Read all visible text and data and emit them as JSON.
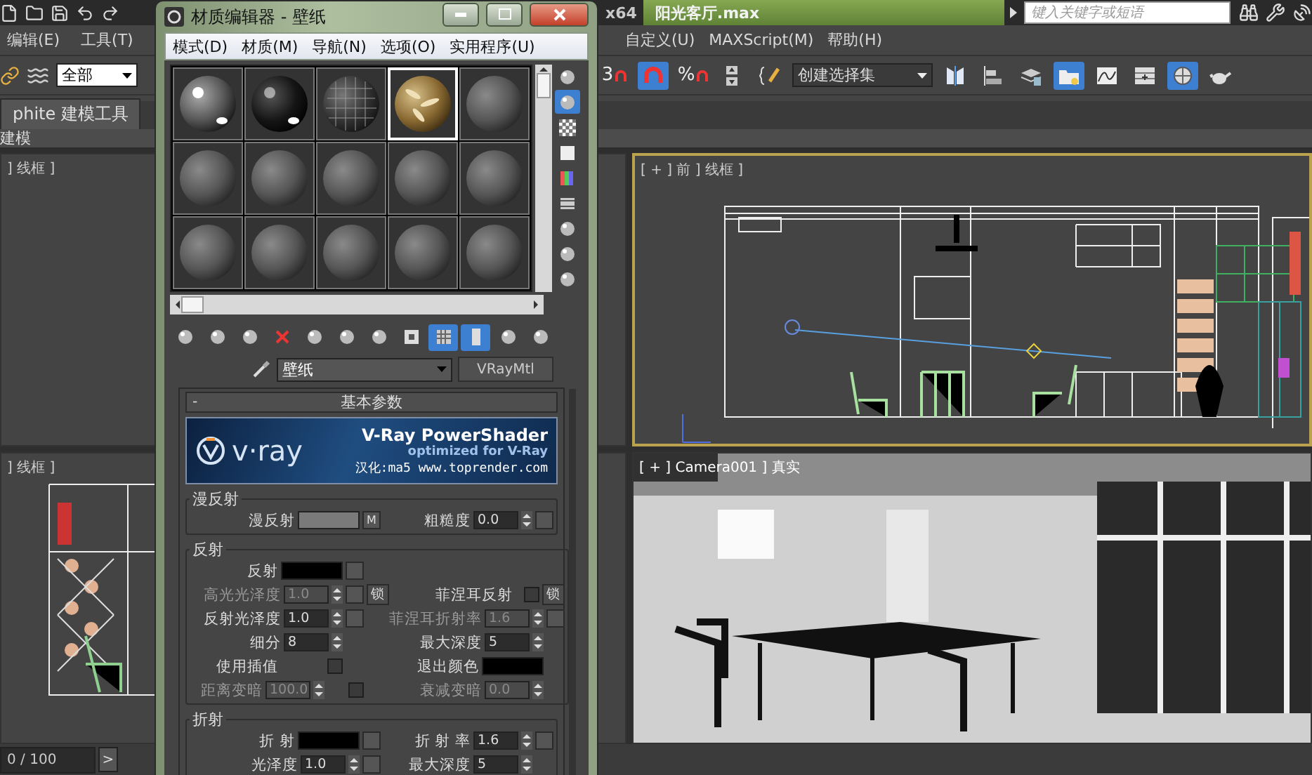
{
  "titlebar": {
    "arch": "x64",
    "file": "阳光客厅.max",
    "search": {
      "placeholder": "键入关键字或短语"
    }
  },
  "menus": {
    "left": [
      "编辑(E)",
      "工具(T)"
    ],
    "right": [
      "自定义(U)",
      "MAXScript(M)",
      "帮助(H)"
    ]
  },
  "toolbar": {
    "selection_filter": "全部",
    "tools": [
      {
        "kind": "snap",
        "label": "3",
        "on": false
      },
      {
        "kind": "angle-snap",
        "on": true
      },
      {
        "kind": "snap",
        "label": "%",
        "on": false
      },
      {
        "kind": "spinner-snap",
        "on": false
      },
      {
        "kind": "edit-named",
        "on": false
      },
      {
        "kind": "named-selection",
        "value": "创建选择集"
      },
      {
        "kind": "mirror",
        "on": false
      },
      {
        "kind": "align",
        "on": false
      },
      {
        "kind": "layers",
        "on": false
      },
      {
        "kind": "explorer",
        "on": true
      },
      {
        "kind": "curve-editor",
        "on": false
      },
      {
        "kind": "schematic",
        "on": false
      },
      {
        "kind": "render-setup",
        "on": true
      },
      {
        "kind": "teapot",
        "on": false
      }
    ]
  },
  "ribbon": {
    "tab": "phite 建模工具",
    "panel": "建模"
  },
  "viewport_top_left": {
    "label": "] 线框 ]",
    "active": false
  },
  "viewport_front": {
    "label": "[ + ] 前 ] 线框 ]",
    "active": true
  },
  "viewport_bottom_left": {
    "label": "] 线框 ]",
    "active": false
  },
  "viewport_camera": {
    "label": "[ + ] Camera001 ] 真实",
    "active": false
  },
  "timeslider": {
    "frame": "0 / 100",
    "next": ">"
  },
  "material_editor": {
    "title": "材质编辑器 - 壁纸",
    "menus": [
      "模式(D)",
      "材质(M)",
      "导航(N)",
      "选项(O)",
      "实用程序(U)"
    ],
    "slots": [
      {
        "kind": "glossy",
        "selected": false
      },
      {
        "kind": "dark",
        "selected": false
      },
      {
        "kind": "mesh",
        "selected": false
      },
      {
        "kind": "wood",
        "selected": true
      },
      {
        "kind": "plain",
        "selected": false
      },
      {
        "kind": "plain",
        "selected": false
      },
      {
        "kind": "plain",
        "selected": false
      },
      {
        "kind": "plain",
        "selected": false
      },
      {
        "kind": "plain",
        "selected": false
      },
      {
        "kind": "plain",
        "selected": false
      },
      {
        "kind": "plain",
        "selected": false
      },
      {
        "kind": "plain",
        "selected": false
      },
      {
        "kind": "plain",
        "selected": false
      },
      {
        "kind": "plain",
        "selected": false
      },
      {
        "kind": "plain",
        "selected": false
      }
    ],
    "side_tools": [
      {
        "kind": "sample-type",
        "on": false
      },
      {
        "kind": "backlight",
        "on": true
      },
      {
        "kind": "checker",
        "on": false
      },
      {
        "kind": "tiling",
        "on": false
      },
      {
        "kind": "video-check",
        "on": false
      },
      {
        "kind": "preview",
        "on": false
      },
      {
        "kind": "options",
        "on": false
      },
      {
        "kind": "select-by-material",
        "on": false
      },
      {
        "kind": "navigator",
        "on": false
      }
    ],
    "tools": [
      {
        "kind": "get",
        "on": false
      },
      {
        "kind": "put",
        "on": false
      },
      {
        "kind": "assign",
        "on": false
      },
      {
        "kind": "reset",
        "on": false
      },
      {
        "kind": "copy",
        "on": false
      },
      {
        "kind": "unique",
        "on": false
      },
      {
        "kind": "library",
        "on": false
      },
      {
        "kind": "effects",
        "on": false
      },
      {
        "kind": "show-map",
        "on": true
      },
      {
        "kind": "end-result",
        "on": true
      },
      {
        "kind": "parent",
        "on": false
      },
      {
        "kind": "sibling",
        "on": false
      }
    ],
    "material_name": "壁纸",
    "material_type": "VRayMtl",
    "rollout": {
      "collapse": "-",
      "title": "基本参数"
    },
    "banner": {
      "logo": "v·ray",
      "title": "V-Ray PowerShader",
      "subtitle": "optimized for V-Ray",
      "credit": "汉化:ma5 www.toprender.com"
    },
    "groups": [
      {
        "title": "漫反射",
        "rows": [
          [
            {
              "label": "漫反射",
              "kind": "swatch",
              "color": "#7a7a7a",
              "map": "M"
            },
            {
              "label": "粗糙度",
              "kind": "spinner",
              "value": "0.0",
              "disabled": false,
              "slot": true
            }
          ]
        ]
      },
      {
        "title": "反射",
        "rows": [
          [
            {
              "label": "反射",
              "kind": "swatch",
              "color": "#000000",
              "slot": true
            }
          ],
          [
            {
              "label": "高光光泽度",
              "kind": "spinner",
              "value": "1.0",
              "disabled": true,
              "slot": true,
              "lock": "锁"
            },
            {
              "label": "菲涅耳反射",
              "kind": "check",
              "checked": false,
              "lock": "锁"
            }
          ],
          [
            {
              "label": "反射光泽度",
              "kind": "spinner",
              "value": "1.0",
              "disabled": false,
              "slot": true
            },
            {
              "label": "菲涅耳折射率",
              "kind": "spinner",
              "value": "1.6",
              "disabled": true,
              "slot": true
            }
          ],
          [
            {
              "label": "细分",
              "kind": "spinner",
              "value": "8",
              "disabled": false
            },
            {
              "label": "最大深度",
              "kind": "spinner",
              "value": "5",
              "disabled": false
            }
          ],
          [
            {
              "label": "使用插值",
              "kind": "check",
              "checked": false
            },
            {
              "label": "退出颜色",
              "kind": "swatch",
              "color": "#000000"
            }
          ],
          [
            {
              "label": "距离变暗",
              "kind": "spinner",
              "value": "100.0",
              "disabled": true,
              "check": false
            },
            {
              "label": "衰减变暗",
              "kind": "spinner",
              "value": "0.0",
              "disabled": true
            }
          ]
        ]
      },
      {
        "title": "折射",
        "rows": [
          [
            {
              "label": "折 射",
              "kind": "swatch",
              "color": "#000000",
              "slot": true
            },
            {
              "label": "折 射 率",
              "kind": "spinner",
              "value": "1.6",
              "disabled": false,
              "slot": true
            }
          ],
          [
            {
              "label": "光泽度",
              "kind": "spinner",
              "value": "1.0",
              "disabled": false,
              "slot": true
            },
            {
              "label": "最大深度",
              "kind": "spinner",
              "value": "5",
              "disabled": false
            }
          ]
        ]
      }
    ]
  }
}
